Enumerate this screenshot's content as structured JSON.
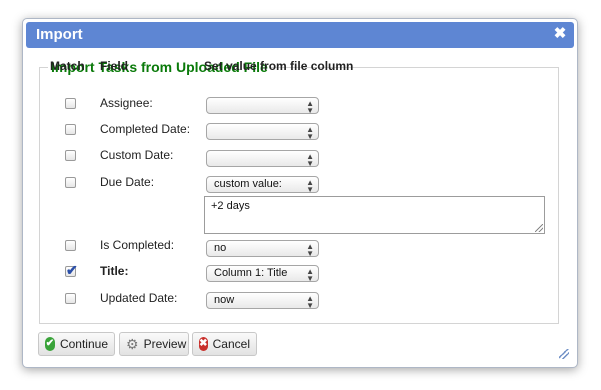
{
  "dialog": {
    "title": "Import",
    "close_glyph": "✖"
  },
  "form": {
    "legend": "Import Tasks from Uploaded File",
    "headers": {
      "match": "Match",
      "field": "Field",
      "column": "Set value from file column"
    },
    "rows": [
      {
        "label": "Assignee:",
        "checked": false,
        "value": ""
      },
      {
        "label": "Completed Date:",
        "checked": false,
        "value": ""
      },
      {
        "label": "Custom Date:",
        "checked": false,
        "value": ""
      },
      {
        "label": "Due Date:",
        "checked": false,
        "value": "custom value:"
      },
      {
        "label": "Is Completed:",
        "checked": false,
        "value": "no"
      },
      {
        "label": "Title:",
        "checked": true,
        "value": "Column 1: Title"
      },
      {
        "label": "Updated Date:",
        "checked": false,
        "value": "now"
      }
    ],
    "custom_value_text": "+2 days"
  },
  "buttons": {
    "continue": "Continue",
    "preview": "Preview",
    "cancel": "Cancel"
  },
  "icons": [
    "close-icon",
    "checkmark-icon",
    "gear-icon",
    "cancel-x-icon"
  ]
}
